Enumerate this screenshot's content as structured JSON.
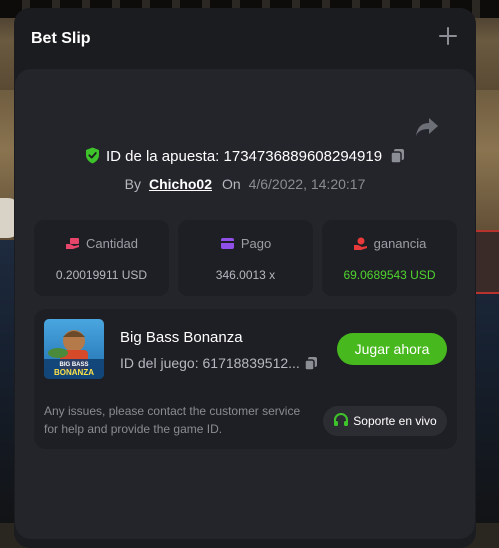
{
  "slip": {
    "title": "Bet Slip",
    "bet_id_label": "ID de la apuesta:",
    "bet_id": "1734736889608294919",
    "by_label": "By",
    "username": "Chicho02",
    "on_label": "On",
    "datetime": "4/6/2022, 14:20:17"
  },
  "stats": [
    {
      "icon": "hand-money-icon",
      "label": "Cantidad",
      "value": "0.20019911 USD"
    },
    {
      "icon": "wallet-icon",
      "label": "Pago",
      "value": "346.0013 x"
    },
    {
      "icon": "hand-coin-icon",
      "label": "ganancia",
      "value": "69.0689543 USD"
    }
  ],
  "game": {
    "name": "Big Bass Bonanza",
    "id_label": "ID del juego:",
    "id_value": "61718839512...",
    "play_label": "Jugar ahora",
    "thumb_text_top": "BIG BASS",
    "thumb_text_bottom": "BONANZA",
    "issues_text": "Any issues, please contact the customer service for help and provide the game ID.",
    "support_label": "Soporte en vivo"
  },
  "colors": {
    "accent_green": "#47b81e",
    "win_green": "#4fd52e",
    "panel": "#1b1c20",
    "card": "#1e1f24"
  }
}
